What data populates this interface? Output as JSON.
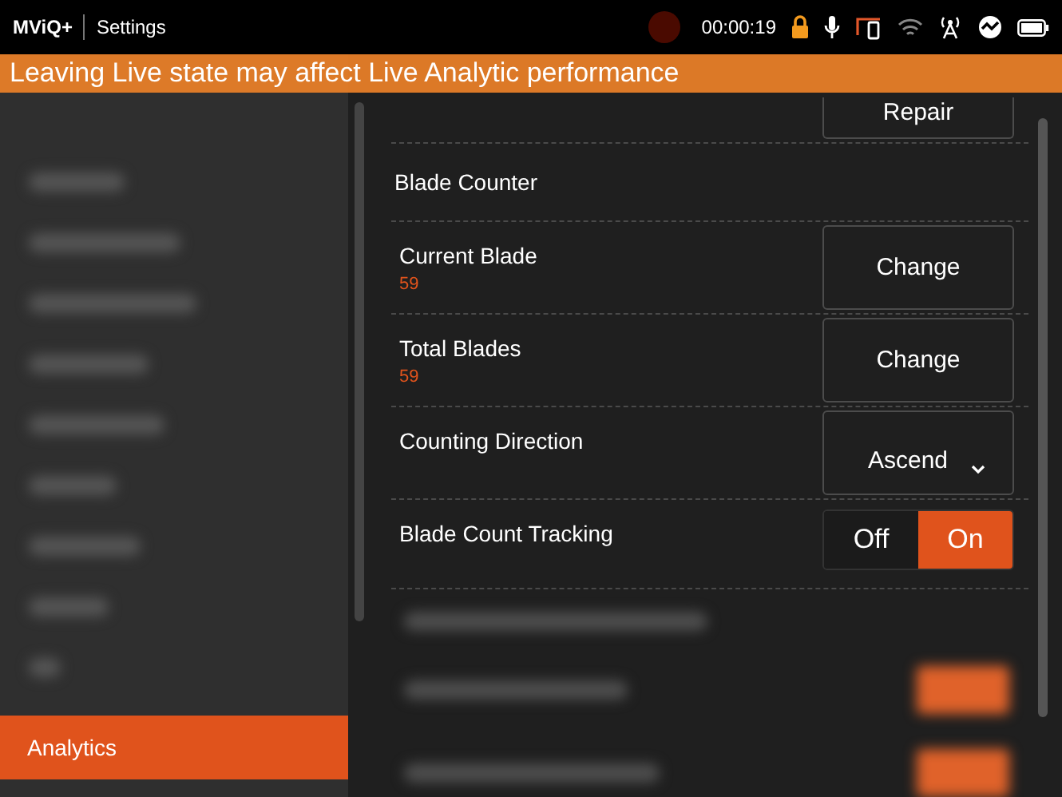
{
  "top_bar": {
    "app_name": "MViQ+",
    "screen": "Settings",
    "timer": "00:00:19"
  },
  "banner": "Leaving Live state may affect Live Analytic performance",
  "sidebar": {
    "items": [
      {
        "label": "Analytics",
        "selected": true
      }
    ]
  },
  "settings": [
    {
      "kind": "button",
      "button": "Repair"
    },
    {
      "kind": "header",
      "label": "Blade Counter"
    },
    {
      "kind": "button",
      "label": "Current Blade",
      "value": "59",
      "button": "Change"
    },
    {
      "kind": "button",
      "label": "Total Blades",
      "value": "59",
      "button": "Change"
    },
    {
      "kind": "dropdown",
      "label": "Counting Direction",
      "value": "Ascend"
    },
    {
      "kind": "toggle",
      "label": "Blade Count Tracking",
      "options": [
        {
          "label": "Off",
          "selected": false
        },
        {
          "label": "On",
          "selected": true
        }
      ]
    }
  ]
}
